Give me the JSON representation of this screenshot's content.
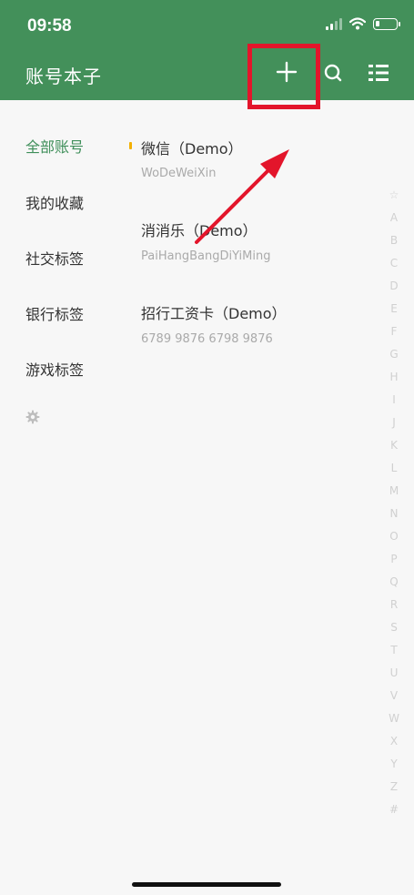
{
  "status": {
    "time": "09:58"
  },
  "header": {
    "title": "账号本子"
  },
  "sidebar": {
    "items": [
      "全部账号",
      "我的收藏",
      "社交标签",
      "银行标签",
      "游戏标签"
    ]
  },
  "accounts": [
    {
      "name": "微信（Demo）",
      "sub": "WoDeWeiXin"
    },
    {
      "name": "消消乐（Demo）",
      "sub": "PaiHangBangDiYiMing"
    },
    {
      "name": "招行工资卡（Demo）",
      "sub": "6789 9876 6798 9876"
    }
  ],
  "index": [
    "☆",
    "A",
    "B",
    "C",
    "D",
    "E",
    "F",
    "G",
    "H",
    "I",
    "J",
    "K",
    "L",
    "M",
    "N",
    "O",
    "P",
    "Q",
    "R",
    "S",
    "T",
    "U",
    "V",
    "W",
    "X",
    "Y",
    "Z",
    "#"
  ],
  "colors": {
    "header": "#43905a",
    "accent": "#3f8f5a",
    "highlight": "#e3152b",
    "marker": "#f3b000"
  }
}
